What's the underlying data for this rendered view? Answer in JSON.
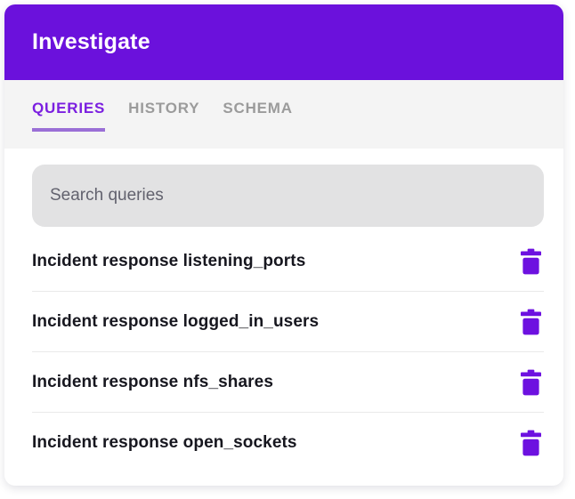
{
  "panel": {
    "title": "Investigate"
  },
  "tabs": [
    {
      "label": "QUERIES",
      "active": true
    },
    {
      "label": "HISTORY",
      "active": false
    },
    {
      "label": "SCHEMA",
      "active": false
    }
  ],
  "search": {
    "placeholder": "Search queries"
  },
  "queries": [
    {
      "name": "Incident response listening_ports"
    },
    {
      "name": "Incident response logged_in_users"
    },
    {
      "name": "Incident response nfs_shares"
    },
    {
      "name": "Incident response open_sockets"
    }
  ],
  "icons": {
    "row_action": "trash-icon"
  },
  "colors": {
    "header_background": "#6b11dc",
    "active_tab_text": "#7b1fe0",
    "tab_underline": "#9a6fd6",
    "inactive_tab_text": "#9b9b9b",
    "tab_bar_background": "#f4f4f4",
    "search_background": "#e2e2e3",
    "item_text": "#17171f",
    "trash_icon": "#6d11e0",
    "divider": "#e9e9e9"
  }
}
